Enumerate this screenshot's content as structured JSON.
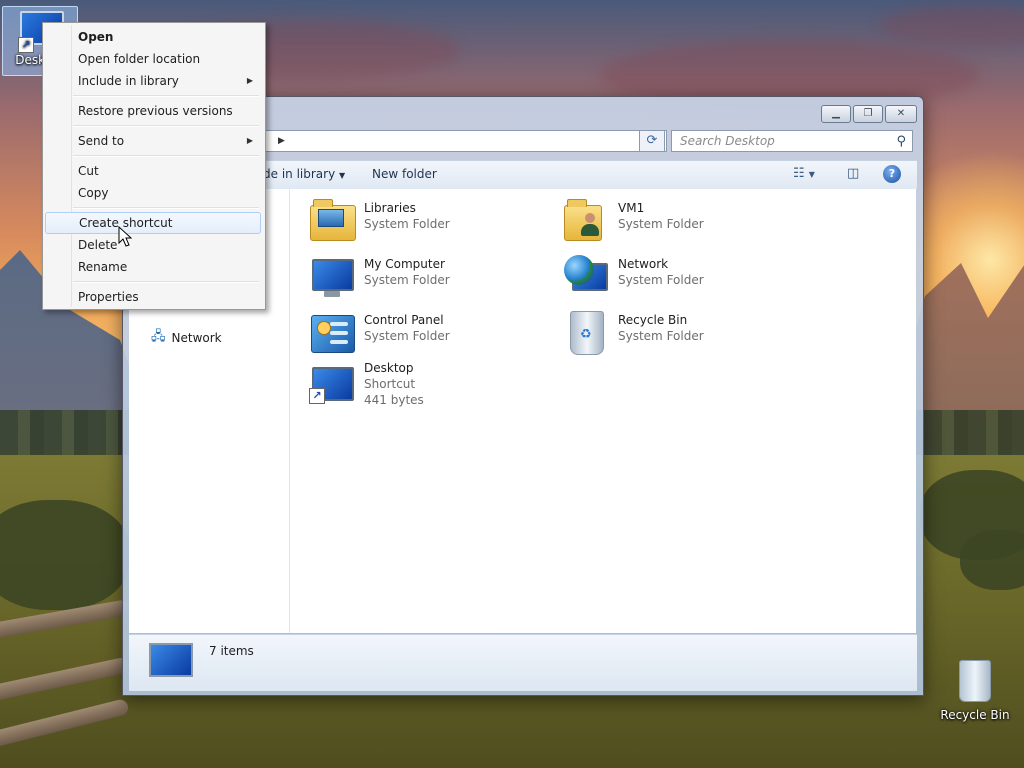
{
  "desktop": {
    "icons": [
      {
        "label": "Desktop"
      },
      {
        "label": "Recycle Bin"
      }
    ]
  },
  "context_menu": {
    "items": [
      {
        "label": "Open"
      },
      {
        "label": "Open folder location"
      },
      {
        "label": "Include in library"
      },
      {
        "label": "Restore previous versions"
      },
      {
        "label": "Send to"
      },
      {
        "label": "Cut"
      },
      {
        "label": "Copy"
      },
      {
        "label": "Create shortcut"
      },
      {
        "label": "Delete"
      },
      {
        "label": "Rename"
      },
      {
        "label": "Properties"
      }
    ]
  },
  "explorer": {
    "search_placeholder": "Search Desktop",
    "toolbar": {
      "include_partial": "de in library",
      "new_folder": "New folder"
    },
    "nav": {
      "network": "Network"
    },
    "items": [
      {
        "name": "Libraries",
        "type": "System Folder"
      },
      {
        "name": "VM1",
        "type": "System Folder"
      },
      {
        "name": "My Computer",
        "type": "System Folder"
      },
      {
        "name": "Network",
        "type": "System Folder"
      },
      {
        "name": "Control Panel",
        "type": "System Folder"
      },
      {
        "name": "Recycle Bin",
        "type": "System Folder"
      },
      {
        "name": "Desktop",
        "type": "Shortcut",
        "size": "441 bytes"
      }
    ],
    "status": {
      "count": "7 items"
    }
  },
  "colors": {
    "menu_hover_border": "#aecff7",
    "selection_blue": "#96bef0",
    "subtext_gray": "#6d6d6d"
  },
  "icons": {
    "window_controls": [
      "minimize-icon",
      "maximize-icon",
      "close-icon"
    ],
    "toolbar": [
      "view-options-icon",
      "preview-pane-icon",
      "help-icon"
    ]
  }
}
